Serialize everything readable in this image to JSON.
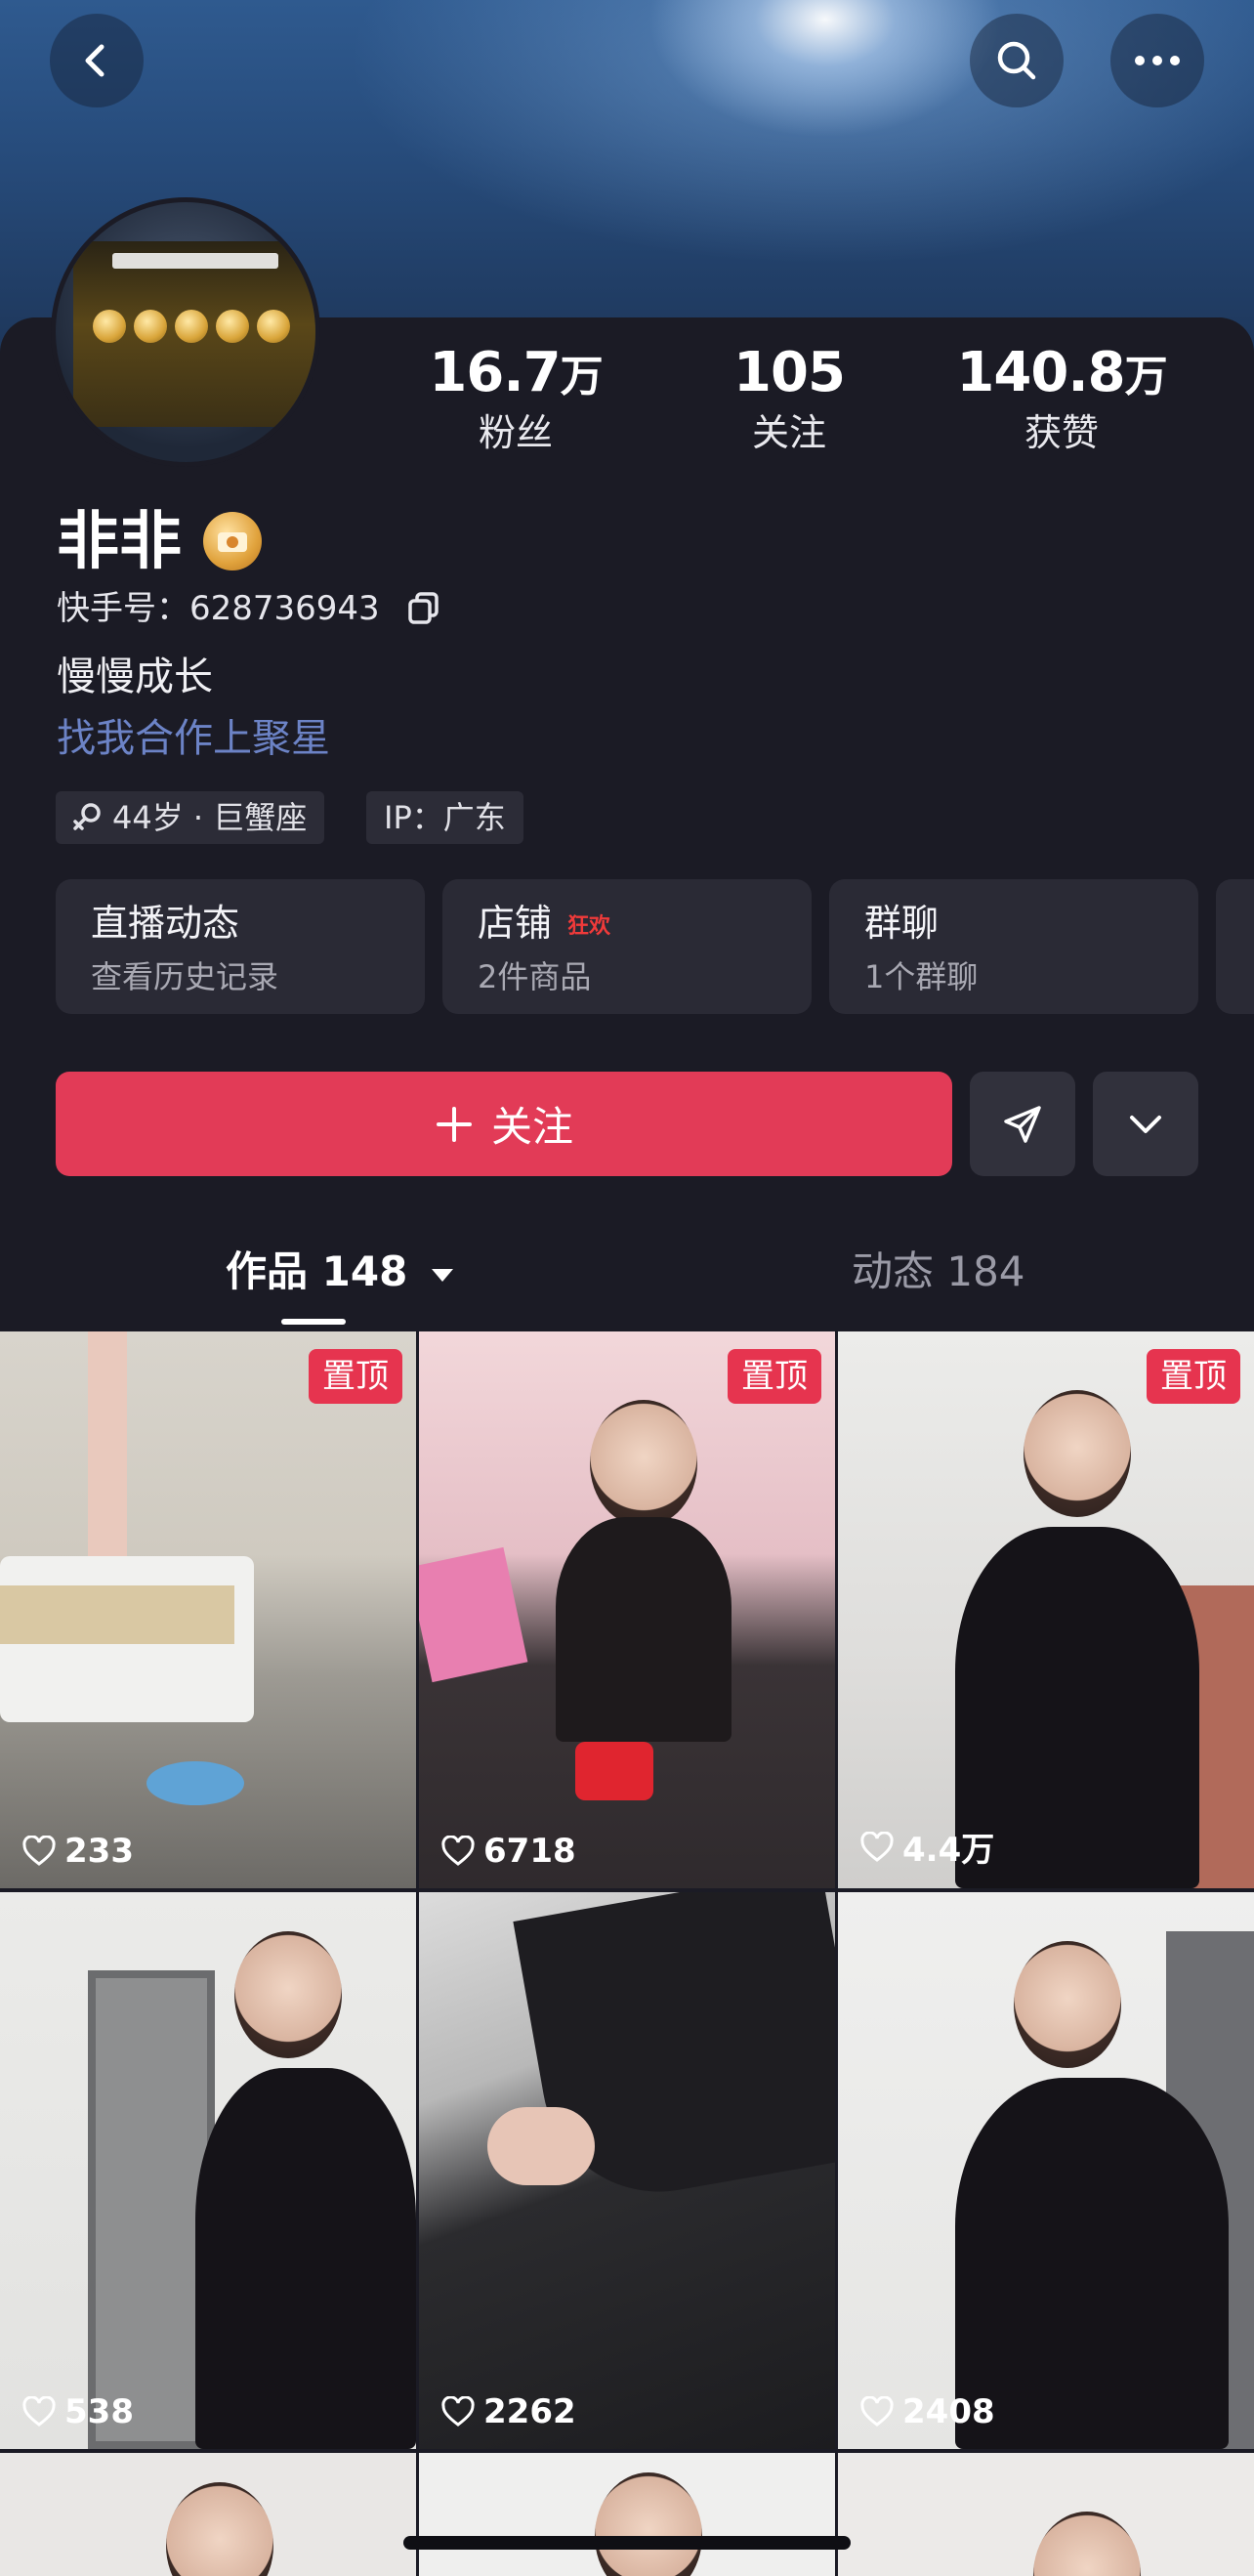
{
  "profile": {
    "name": "非非",
    "id_label": "快手号：",
    "id_value": "628736943",
    "bio": "慢慢成长",
    "link_text": "找我合作上聚星",
    "tags": [
      "44岁 · 巨蟹座",
      "IP：广东"
    ]
  },
  "stats": [
    {
      "value": "16.7",
      "unit": "万",
      "label": "粉丝"
    },
    {
      "value": "105",
      "unit": "",
      "label": "关注"
    },
    {
      "value": "140.8",
      "unit": "万",
      "label": "获赞"
    }
  ],
  "cards": [
    {
      "title": "直播动态",
      "subtitle": "查看历史记录",
      "hot": ""
    },
    {
      "title": "店铺",
      "subtitle": "2件商品",
      "hot": "狂欢"
    },
    {
      "title": "群聊",
      "subtitle": "1个群聊",
      "hot": ""
    }
  ],
  "actions": {
    "follow_label": "关注",
    "icons": [
      "back-icon",
      "search-icon",
      "more-icon",
      "send-icon",
      "chevron-down-icon",
      "plus-icon",
      "copy-icon"
    ]
  },
  "tabs": [
    {
      "label": "作品 148",
      "active": true
    },
    {
      "label": "动态 184",
      "active": false
    }
  ],
  "pinned_label": "置顶",
  "videos": [
    {
      "likes": "233",
      "pinned": true
    },
    {
      "likes": "6718",
      "pinned": true
    },
    {
      "likes": "4.4万",
      "pinned": true
    },
    {
      "likes": "538",
      "pinned": false
    },
    {
      "likes": "2262",
      "pinned": false
    },
    {
      "likes": "2408",
      "pinned": false
    }
  ],
  "colors": {
    "accent": "#e23b57",
    "background": "#1b1b25",
    "link": "#6c83c6",
    "hot": "#f03a3a"
  }
}
